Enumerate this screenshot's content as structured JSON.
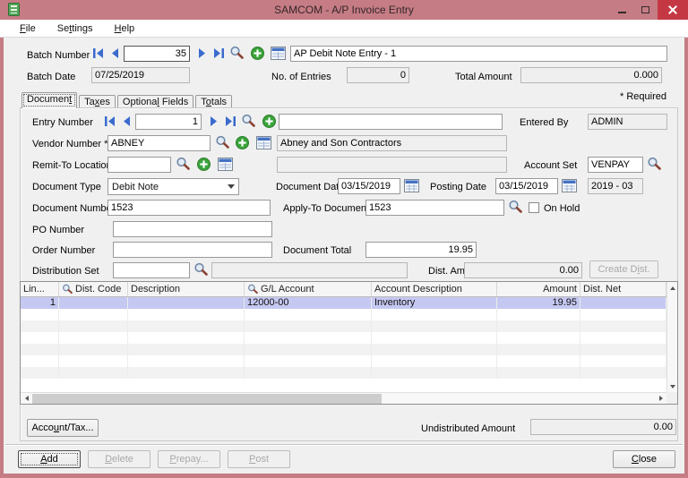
{
  "window": {
    "title": "SAMCOM - A/P Invoice Entry"
  },
  "colors": {
    "frame": "#c67c84",
    "close_button": "#c43844",
    "accent_blue": "#3a6bcd",
    "accent_green": "#3aa33a",
    "selected_row": "#c5c8f1"
  },
  "menu": {
    "items": [
      {
        "pre": "",
        "accel": "F",
        "post": "ile"
      },
      {
        "pre": "Se",
        "accel": "t",
        "post": "tings"
      },
      {
        "pre": "",
        "accel": "H",
        "post": "elp"
      }
    ]
  },
  "batch": {
    "number_label": "Batch Number",
    "number_value": "35",
    "description": "AP Debit Note Entry - 1",
    "date_label": "Batch Date",
    "date_value": "07/25/2019",
    "entries_label": "No. of Entries",
    "entries_value": "0",
    "total_label": "Total Amount",
    "total_value": "0.000"
  },
  "required_note": "* Required",
  "tabs": [
    {
      "pre": "Documen",
      "accel": "t",
      "post": ""
    },
    {
      "pre": "Ta",
      "accel": "x",
      "post": "es"
    },
    {
      "pre": "Optiona",
      "accel": "l",
      "post": " Fields"
    },
    {
      "pre": "T",
      "accel": "o",
      "post": "tals"
    }
  ],
  "form": {
    "entry_number": {
      "label": "Entry Number",
      "value": "1",
      "description": ""
    },
    "entered_by": {
      "label": "Entered By",
      "value": "ADMIN"
    },
    "vendor": {
      "label": "Vendor Number *",
      "value": "ABNEY",
      "description": "Abney and Son Contractors"
    },
    "remit_to": {
      "label": "Remit-To Location",
      "value": "",
      "description": ""
    },
    "account_set": {
      "label": "Account Set",
      "value": "VENPAY"
    },
    "document_type": {
      "label": "Document Type",
      "value": "Debit Note"
    },
    "document_date": {
      "label": "Document Date",
      "value": "03/15/2019"
    },
    "posting_date": {
      "label": "Posting Date",
      "value": "03/15/2019"
    },
    "fiscal_period": "2019 - 03",
    "document_number": {
      "label": "Document Number *",
      "value": "1523"
    },
    "apply_to": {
      "label": "Apply-To Document",
      "value": "1523"
    },
    "on_hold_label": "On Hold",
    "po_number": {
      "label": "PO Number",
      "value": ""
    },
    "order_number": {
      "label": "Order Number",
      "value": ""
    },
    "document_total": {
      "label": "Document Total",
      "value": "19.95"
    },
    "distribution_set": {
      "label": "Distribution Set",
      "value": "",
      "description": ""
    },
    "dist_amount": {
      "label": "Dist. Amount",
      "value": "0.00"
    },
    "create_dist": {
      "pre": "Create D",
      "accel": "i",
      "post": "st."
    }
  },
  "grid": {
    "headers": {
      "line": "Lin...",
      "dist_code": "Dist. Code",
      "description": "Description",
      "gl_account": "G/L Account",
      "account_description": "Account Description",
      "amount": "Amount",
      "dist_net": "Dist. Net"
    },
    "rows": [
      {
        "line": "1",
        "dist_code": "",
        "description": "",
        "gl_account": "12000-00",
        "account_description": "Inventory",
        "amount": "19.95",
        "dist_net": ""
      }
    ]
  },
  "footer": {
    "account_tax": {
      "pre": "Acco",
      "accel": "u",
      "post": "nt/Tax..."
    },
    "undistributed_label": "Undistributed Amount",
    "undistributed_value": "0.00"
  },
  "buttons": {
    "add": {
      "pre": "",
      "accel": "A",
      "post": "dd"
    },
    "delete": {
      "pre": "",
      "accel": "D",
      "post": "elete"
    },
    "prepay": {
      "pre": "",
      "accel": "P",
      "post": "repay..."
    },
    "post": {
      "pre": "",
      "accel": "P",
      "post": "ost"
    },
    "close": {
      "pre": "",
      "accel": "C",
      "post": "lose"
    }
  }
}
